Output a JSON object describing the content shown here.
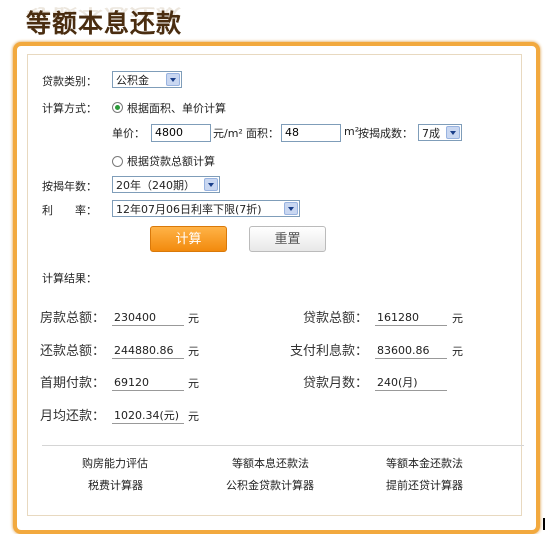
{
  "page": {
    "title": "等额本息还款"
  },
  "form": {
    "loan_type": {
      "label": "贷款类别：",
      "value": "公积金"
    },
    "calc_method": {
      "label": "计算方式：",
      "option_area": "根据面积、单价计算",
      "option_total": "根据贷款总额计算",
      "selected": "area"
    },
    "unit_price": {
      "label": "单价：",
      "value": "4800",
      "unit": "元/m²"
    },
    "area": {
      "label": "面积：",
      "value": "48",
      "unit": "m²"
    },
    "ratio": {
      "label": "按揭成数：",
      "value": "7成"
    },
    "years": {
      "label": "按揭年数：",
      "value": "20年（240期）"
    },
    "rate": {
      "label": "利　　率：",
      "value": "12年07月06日利率下限(7折)"
    }
  },
  "buttons": {
    "calculate": "计算",
    "reset": "重置"
  },
  "results": {
    "label": "计算结果：",
    "house_total": {
      "label": "房款总额：",
      "value": "230400",
      "unit": "元"
    },
    "loan_total": {
      "label": "贷款总额：",
      "value": "161280",
      "unit": "元"
    },
    "repay_total": {
      "label": "还款总额：",
      "value": "244880.86",
      "unit": "元"
    },
    "interest_total": {
      "label": "支付利息款：",
      "value": "83600.86",
      "unit": "元"
    },
    "down_payment": {
      "label": "首期付款：",
      "value": "69120",
      "unit": "元"
    },
    "loan_months": {
      "label": "贷款月数：",
      "value": "240(月)"
    },
    "monthly": {
      "label": "月均还款：",
      "value": "1020.34(元)",
      "unit": "元"
    }
  },
  "links": {
    "row1": [
      "购房能力评估",
      "等额本息还款法",
      "等额本金还款法"
    ],
    "row2": [
      "税费计算器",
      "公积金贷款计算器",
      "提前还贷计算器"
    ]
  },
  "colors": {
    "accent": "#f2a93e",
    "button_orange": "#f28a0d",
    "radio_checked": "#2b9a3a"
  }
}
